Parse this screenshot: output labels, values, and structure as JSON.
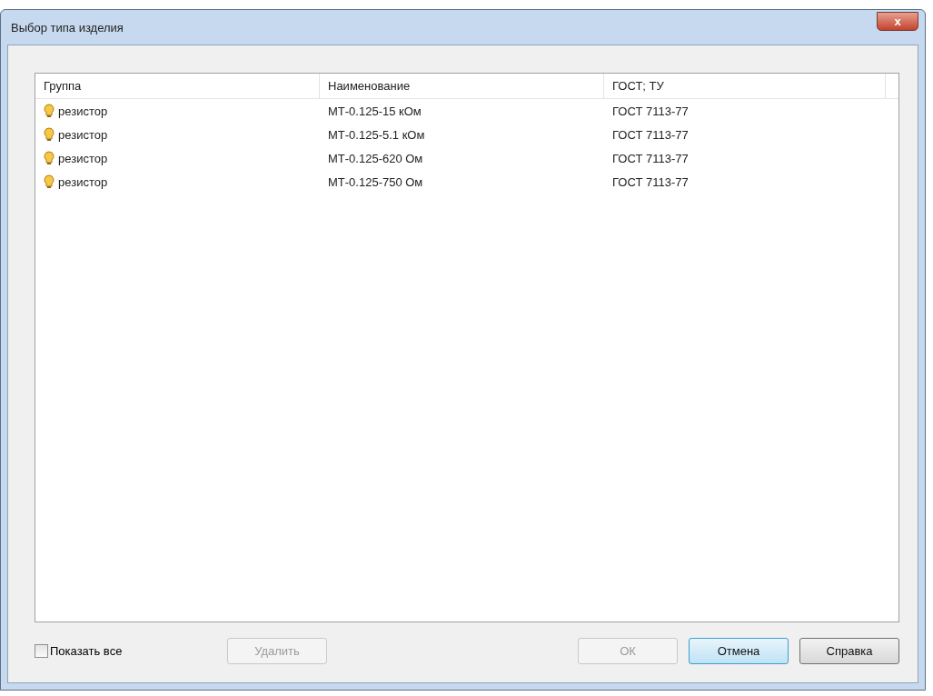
{
  "window": {
    "title": "Выбор типа изделия",
    "close": "x"
  },
  "table": {
    "columns": [
      "Группа",
      "Наименование",
      "ГОСТ; ТУ"
    ],
    "rows": [
      {
        "group": "резистор",
        "name": "МТ-0.125-15 кОм",
        "standard": "ГОСТ 7113-77"
      },
      {
        "group": "резистор",
        "name": "МТ-0.125-5.1 кОм",
        "standard": "ГОСТ 7113-77"
      },
      {
        "group": "резистор",
        "name": "МТ-0.125-620 Ом",
        "standard": "ГОСТ 7113-77"
      },
      {
        "group": "резистор",
        "name": "МТ-0.125-750 Ом",
        "standard": "ГОСТ 7113-77"
      }
    ]
  },
  "show_all": {
    "label": "Показать все",
    "checked": false
  },
  "buttons": [
    {
      "label": "Удалить",
      "disabled": true,
      "focused": false
    },
    {
      "label": "ОК",
      "disabled": true,
      "focused": false
    },
    {
      "label": "Отмена",
      "disabled": false,
      "focused": true
    },
    {
      "label": "Справка",
      "disabled": false,
      "focused": false
    }
  ]
}
